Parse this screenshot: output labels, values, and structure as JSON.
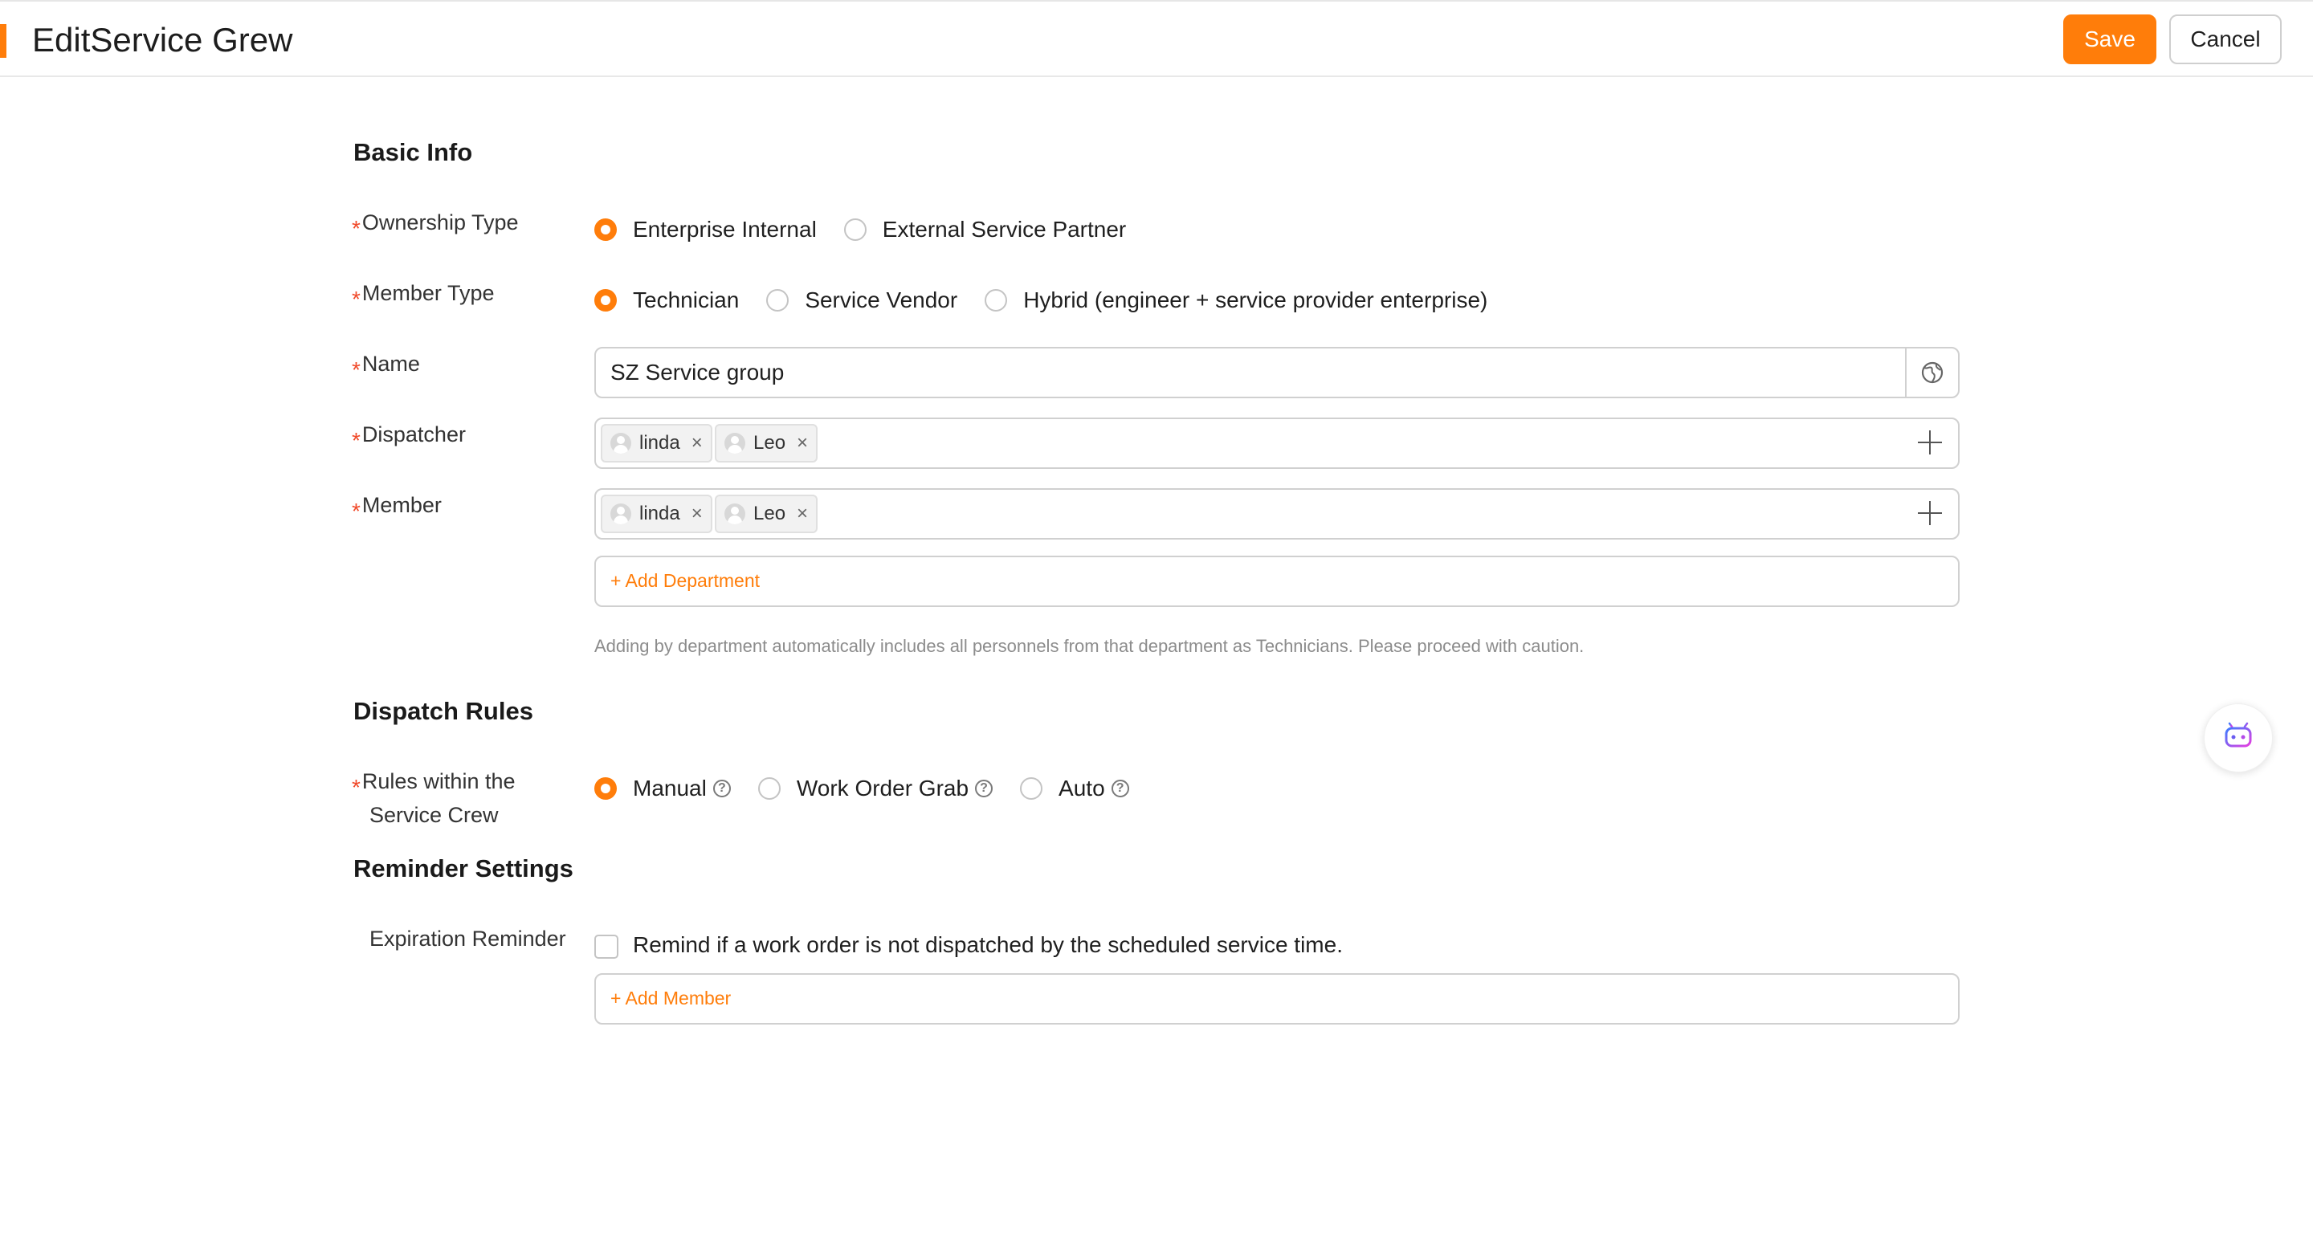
{
  "header": {
    "title": "EditService Grew",
    "save_label": "Save",
    "cancel_label": "Cancel"
  },
  "basic_info": {
    "title": "Basic Info",
    "ownership": {
      "label": "Ownership Type",
      "options": [
        "Enterprise Internal",
        "External Service Partner"
      ],
      "selected": "Enterprise Internal"
    },
    "member_type": {
      "label": "Member Type",
      "options": [
        "Technician",
        "Service Vendor",
        "Hybrid (engineer + service provider enterprise)"
      ],
      "selected": "Technician"
    },
    "name": {
      "label": "Name",
      "value": "SZ Service group",
      "icon": "globe-icon"
    },
    "dispatcher": {
      "label": "Dispatcher",
      "tags": [
        "linda",
        "Leo"
      ]
    },
    "member": {
      "label": "Member",
      "tags": [
        "linda",
        "Leo"
      ],
      "add_department": "+ Add Department",
      "hint": "Adding by department automatically includes all personnels from that department as Technicians. Please proceed with caution."
    }
  },
  "dispatch_rules": {
    "title": "Dispatch Rules",
    "rules_label_line1": "Rules within the",
    "rules_label_line2": "Service Crew",
    "options": [
      "Manual",
      "Work Order Grab",
      "Auto"
    ],
    "selected": "Manual"
  },
  "reminder_settings": {
    "title": "Reminder Settings",
    "expiration_label": "Expiration Reminder",
    "checkbox_text": "Remind if a work order is not dispatched by the scheduled service time.",
    "checked": false,
    "add_member": "+ Add Member"
  },
  "colors": {
    "accent": "#ff7d0a",
    "required": "#f04a2a"
  }
}
